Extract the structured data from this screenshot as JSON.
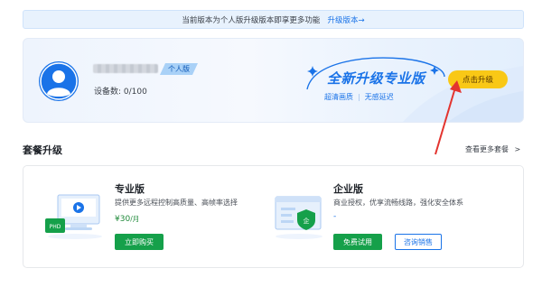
{
  "notice": {
    "text": "当前版本为个人版升级版本即享更多功能",
    "link": "升级版本→"
  },
  "user": {
    "plan_tag": "个人版",
    "device_count": "设备数: 0/100"
  },
  "promo": {
    "title": "全新升级专业版",
    "feature1": "超清画质",
    "separator": "|",
    "feature2": "无感延迟",
    "button": "点击升级"
  },
  "section": {
    "title": "套餐升级",
    "more_link": "查看更多套餐",
    "more_chevron": ">"
  },
  "plans": [
    {
      "name": "专业版",
      "desc": "提供更多远程控制高质量、高帧率选择",
      "price": "¥30",
      "unit": "/月",
      "primary_button": "立即购买",
      "icon_label": "PHD"
    },
    {
      "name": "企业版",
      "desc": "商业授权，优享流畅线路，强化安全体系",
      "price": "-",
      "primary_button": "免费试用",
      "secondary_button": "咨询销售",
      "icon_label": "企"
    }
  ],
  "colors": {
    "brand_blue": "#1a73e8",
    "upgrade_yellow": "#f9c816",
    "action_green": "#15a04a",
    "arrow_red": "#e3342f"
  }
}
